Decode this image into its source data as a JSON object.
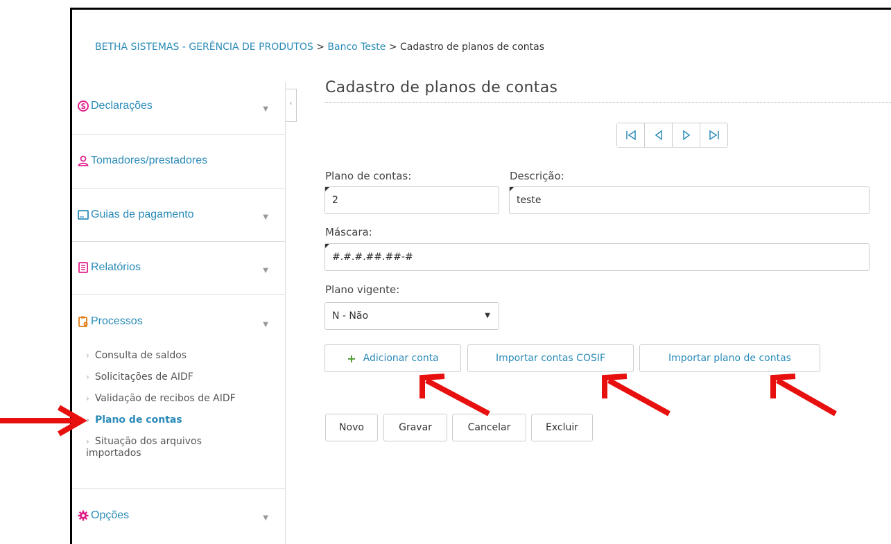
{
  "breadcrumb": {
    "part1": "BETHA SISTEMAS - GERÊNCIA DE PRODUTOS",
    "sep": " > ",
    "part2": "Banco Teste",
    "part3": "Cadastro de planos de contas"
  },
  "sidebar": {
    "declaracoes": "Declarações",
    "tomadores": "Tomadores/prestadores",
    "guias": "Guias de pagamento",
    "relatorios": "Relatórios",
    "processos": "Processos",
    "opcoes": "Opções",
    "sub": [
      "Consulta de saldos",
      "Solicitações de AIDF",
      "Validação de recibos de AIDF",
      "Plano de contas",
      "Situação dos arquivos importados"
    ]
  },
  "page": {
    "title": "Cadastro de planos de contas"
  },
  "form": {
    "plano_label": "Plano de contas:",
    "plano_value": "2",
    "descricao_label": "Descrição:",
    "descricao_value": "teste",
    "mascara_label": "Máscara:",
    "mascara_value": "#.#.#.##.##-#",
    "vigente_label": "Plano vigente:",
    "vigente_value": "N - Não"
  },
  "actions": {
    "adicionar": "Adicionar conta",
    "importar_cosif": "Importar contas COSIF",
    "importar_plano": "Importar plano de contas",
    "novo": "Novo",
    "gravar": "Gravar",
    "cancelar": "Cancelar",
    "excluir": "Excluir"
  },
  "colors": {
    "accent": "#2a8bb8",
    "annotation": "#e8100f",
    "declaracoes_icon": "#e0218a",
    "tomadores_icon": "#e0218a",
    "guias_icon": "#2a8bb8",
    "relatorios_icon": "#e0218a",
    "processos_icon": "#e07a10",
    "opcoes_icon": "#e0218a"
  }
}
